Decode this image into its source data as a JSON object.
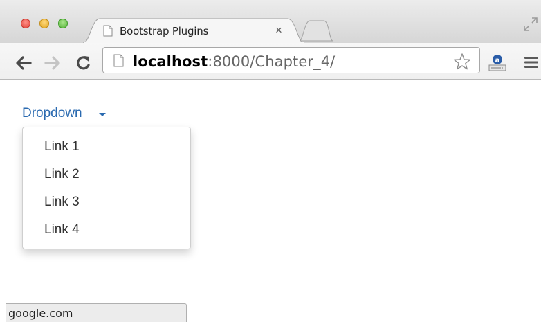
{
  "browser": {
    "tab": {
      "title": "Bootstrap Plugins",
      "close_label": "×"
    },
    "address": {
      "host": "localhost",
      "rest": ":8000/Chapter_4/"
    },
    "icons": {
      "window_controls": [
        "close-icon",
        "minimize-icon",
        "zoom-icon"
      ],
      "navigation": [
        "back-arrow-icon",
        "forward-arrow-icon",
        "reload-icon"
      ],
      "omnibox": [
        "page-icon",
        "star-icon"
      ],
      "toolbar": [
        "extension-icon",
        "menu-icon"
      ],
      "fullscreen": "fullscreen-icon"
    },
    "colors": {
      "close": "#e0443a",
      "minimize": "#e2a824",
      "zoom": "#58b43a"
    }
  },
  "page": {
    "dropdown": {
      "label": "Dropdown",
      "link_color": "#2a6ab0",
      "items": [
        "Link 1",
        "Link 2",
        "Link 3",
        "Link 4"
      ]
    }
  },
  "status": {
    "text": "google.com"
  }
}
